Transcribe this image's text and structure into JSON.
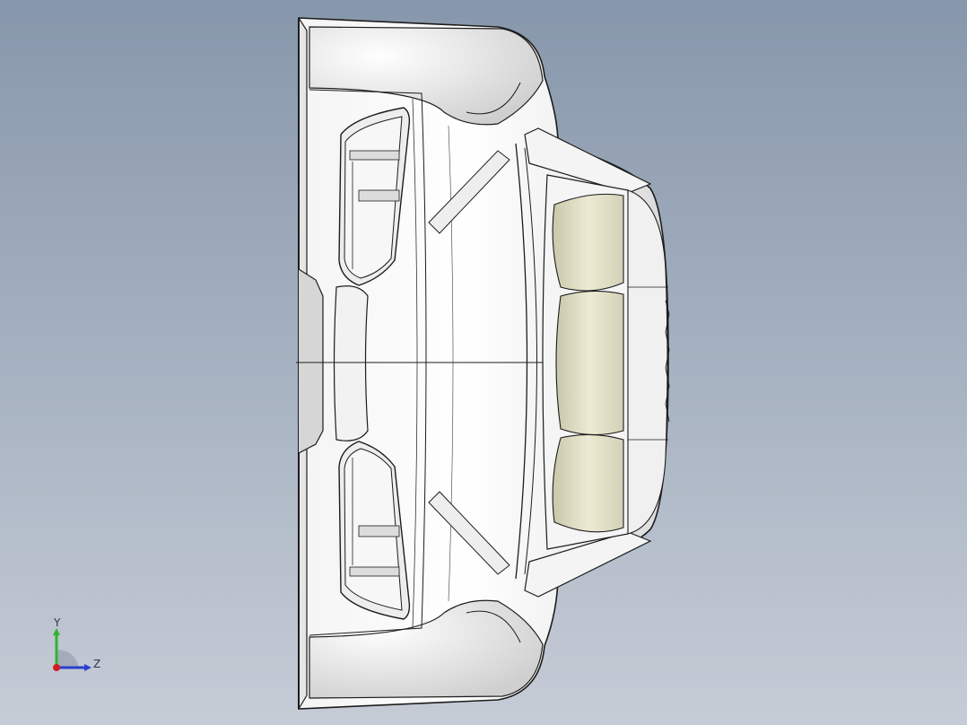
{
  "view": {
    "background_top": "#8797ab",
    "background_bottom": "#c6ccd6",
    "model_fill": "#ffffff",
    "model_edge": "#1c1c1c",
    "seat_fill": "#e4e2c8"
  },
  "triad": {
    "y_label": "Y",
    "z_label": "Z",
    "y_color": "#2fb52f",
    "z_color": "#2a3fd0",
    "x_color": "#d21e1e"
  }
}
